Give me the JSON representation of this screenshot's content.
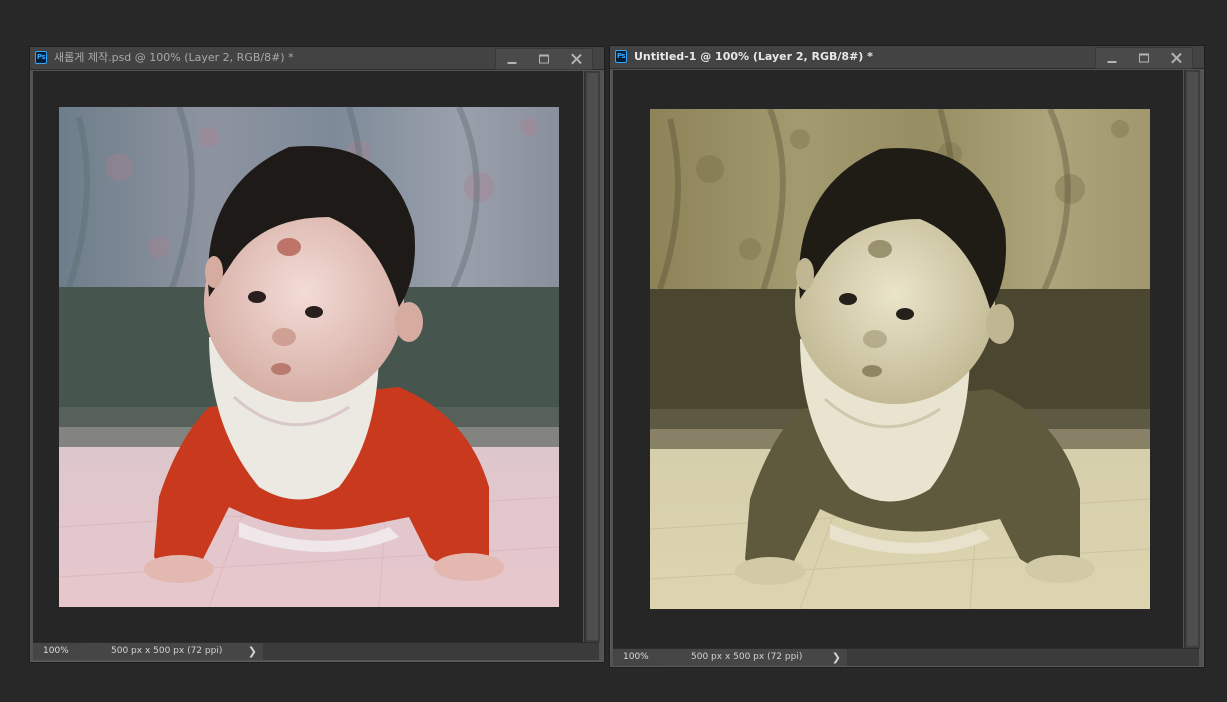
{
  "windows": [
    {
      "title": "새롭게 제작.psd @ 100% (Layer 2, RGB/8#) *",
      "zoom": "100%",
      "doc_info": "500 px x 500 px (72 ppi)",
      "status_arrow": "❯",
      "active": false,
      "image_tone": "color"
    },
    {
      "title": "Untitled-1 @ 100% (Layer 2, RGB/8#) *",
      "zoom": "100%",
      "doc_info": "500 px x 500 px (72 ppi)",
      "status_arrow": "❯",
      "active": true,
      "image_tone": "sepia"
    }
  ],
  "app_icon_label": "Ps",
  "icons": [
    "photoshop-doc-icon",
    "minimize-icon",
    "maximize-icon",
    "close-icon",
    "chevron-right-icon"
  ],
  "colors": {
    "ps_blue": "#31a8ff",
    "workspace_bg": "#282828",
    "canvas_bg": "#262626"
  }
}
